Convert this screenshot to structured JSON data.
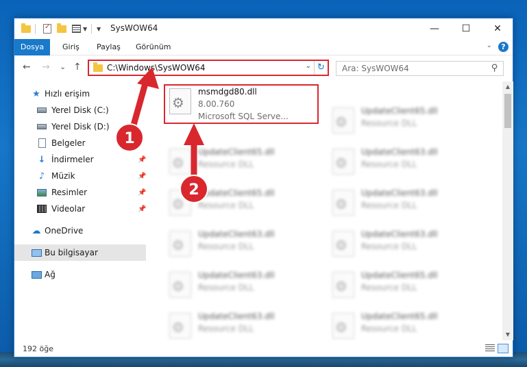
{
  "window": {
    "title": "SysWOW64",
    "minimize": "—",
    "maximize": "☐",
    "close": "✕"
  },
  "ribbon": {
    "tabs": [
      "Dosya",
      "Giriş",
      "Paylaş",
      "Görünüm"
    ],
    "help": "?"
  },
  "nav": {
    "back": "←",
    "forward": "→",
    "recent": "⌄",
    "up": "↑",
    "address": "C:\\Windows\\SysWOW64",
    "search_placeholder": "Ara: SysWOW64"
  },
  "sidebar": {
    "items": [
      {
        "label": "Hızlı erişim",
        "icon": "star-icon"
      },
      {
        "label": "Yerel Disk (C:)",
        "icon": "disk-icon"
      },
      {
        "label": "Yerel Disk (D:)",
        "icon": "disk-icon"
      },
      {
        "label": "Belgeler",
        "icon": "documents-icon"
      },
      {
        "label": "İndirmeler",
        "icon": "download-icon"
      },
      {
        "label": "Müzik",
        "icon": "music-icon"
      },
      {
        "label": "Resimler",
        "icon": "pictures-icon"
      },
      {
        "label": "Videolar",
        "icon": "videos-icon"
      },
      {
        "label": "OneDrive",
        "icon": "onedrive-icon"
      },
      {
        "label": "Bu bilgisayar",
        "icon": "this-pc-icon"
      },
      {
        "label": "Ağ",
        "icon": "network-icon"
      }
    ]
  },
  "files": {
    "highlighted": {
      "name": "msmdgd80.dll",
      "version": "8.00.760",
      "description": "Microsoft SQL Serve..."
    },
    "col1": [
      {
        "name": "UpdateClient65.dll",
        "type": "Resource DLL"
      },
      {
        "name": "UpdateClient65.dll",
        "type": "Resource DLL"
      },
      {
        "name": "UpdateClient63.dll",
        "type": "Resource DLL"
      },
      {
        "name": "UpdateClient63.dll",
        "type": "Resource DLL"
      },
      {
        "name": "UpdateClient63.dll",
        "type": "Resource DLL"
      }
    ],
    "col2": [
      {
        "name": "UpdateClient65.dll",
        "type": "Resource DLL"
      },
      {
        "name": "UpdateClient63.dll",
        "type": "Resource DLL"
      },
      {
        "name": "UpdateClient63.dll",
        "type": "Resource DLL"
      },
      {
        "name": "UpdateClient63.dll",
        "type": "Resource DLL"
      },
      {
        "name": "UpdateClient65.dll",
        "type": "Resource DLL"
      },
      {
        "name": "UpdateClient65.dll",
        "type": "Resource DLL"
      }
    ]
  },
  "status": {
    "count": "192 öğe"
  },
  "annotations": {
    "badge1": "1",
    "badge2": "2",
    "color": "#d9272e"
  }
}
